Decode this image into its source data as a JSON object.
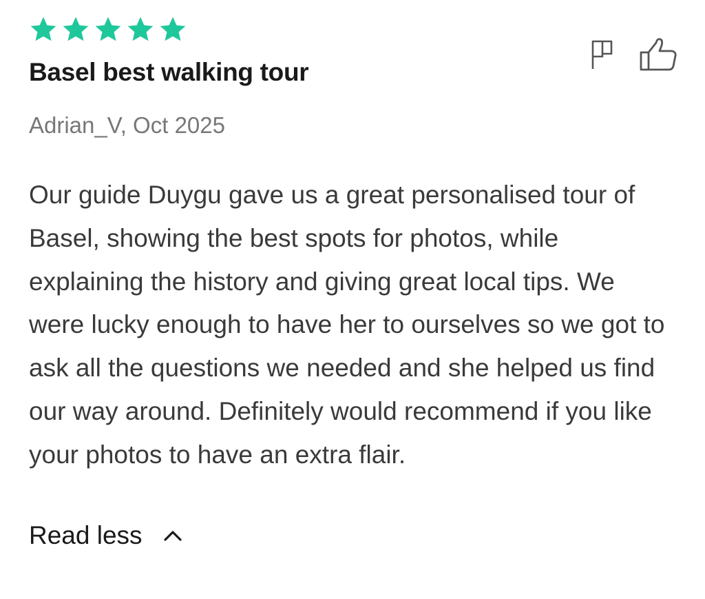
{
  "review": {
    "rating": 5,
    "rating_max": 5,
    "star_color": "#1FC89A",
    "title": "Basel best walking tour",
    "meta": "Adrian_V, Oct 2025",
    "body": "Our guide Duygu gave us a great personalised tour of Basel, showing the best spots for photos, while explaining the history and giving great local tips. We were lucky enough to have her to ourselves so we got to ask all the questions we needed and she helped us find our way around. Definitely would recommend if you like your photos to have an extra flair.",
    "read_less_label": "Read less",
    "icons": {
      "star": "star-icon",
      "flag": "flag-icon",
      "like": "thumbs-up-icon",
      "collapse": "chevron-up-icon"
    }
  }
}
